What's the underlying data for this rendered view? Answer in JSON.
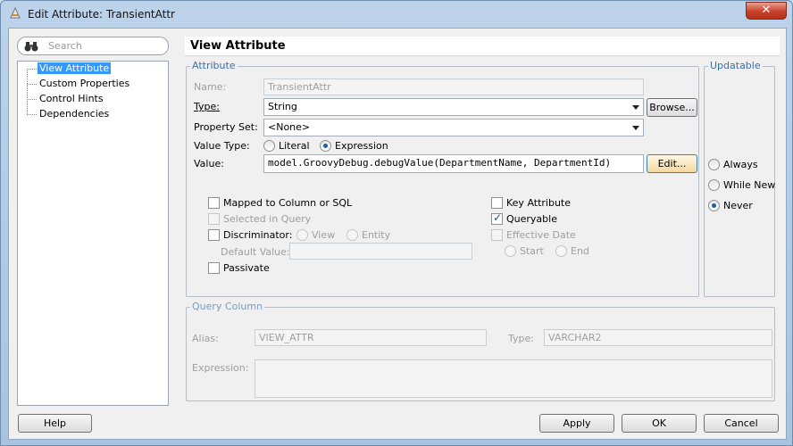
{
  "window": {
    "title": "Edit Attribute: TransientAttr",
    "close": "✕"
  },
  "search": {
    "placeholder": "Search"
  },
  "nav": {
    "items": [
      {
        "label": "View Attribute"
      },
      {
        "label": "Custom Properties"
      },
      {
        "label": "Control Hints"
      },
      {
        "label": "Dependencies"
      }
    ]
  },
  "panel": {
    "title": "View Attribute"
  },
  "attribute": {
    "legend": "Attribute",
    "name_label": "Name:",
    "name_value": "TransientAttr",
    "type_label": "Type:",
    "type_value": "String",
    "browse_label": "Browse...",
    "property_set_label": "Property Set:",
    "property_set_value": "<None>",
    "value_type_label": "Value Type:",
    "literal_label": "Literal",
    "expression_label": "Expression",
    "value_label": "Value:",
    "value_value": "model.GroovyDebug.debugValue(DepartmentName, DepartmentId)",
    "edit_label": "Edit...",
    "mapped_label": "Mapped to Column or SQL",
    "selected_in_query_label": "Selected in Query",
    "discriminator_label": "Discriminator:",
    "view_label": "View",
    "entity_label": "Entity",
    "default_value_label": "Default Value:",
    "passivate_label": "Passivate",
    "key_attribute_label": "Key Attribute",
    "queryable_label": "Queryable",
    "effective_date_label": "Effective Date",
    "start_label": "Start",
    "end_label": "End"
  },
  "updatable": {
    "legend": "Updatable",
    "always": "Always",
    "while_new": "While New",
    "never": "Never"
  },
  "query_column": {
    "legend": "Query Column",
    "alias_label": "Alias:",
    "alias_value": "VIEW_ATTR",
    "type_label": "Type:",
    "type_value": "VARCHAR2",
    "expression_label": "Expression:"
  },
  "footer": {
    "help": "Help",
    "apply": "Apply",
    "ok": "OK",
    "cancel": "Cancel"
  }
}
